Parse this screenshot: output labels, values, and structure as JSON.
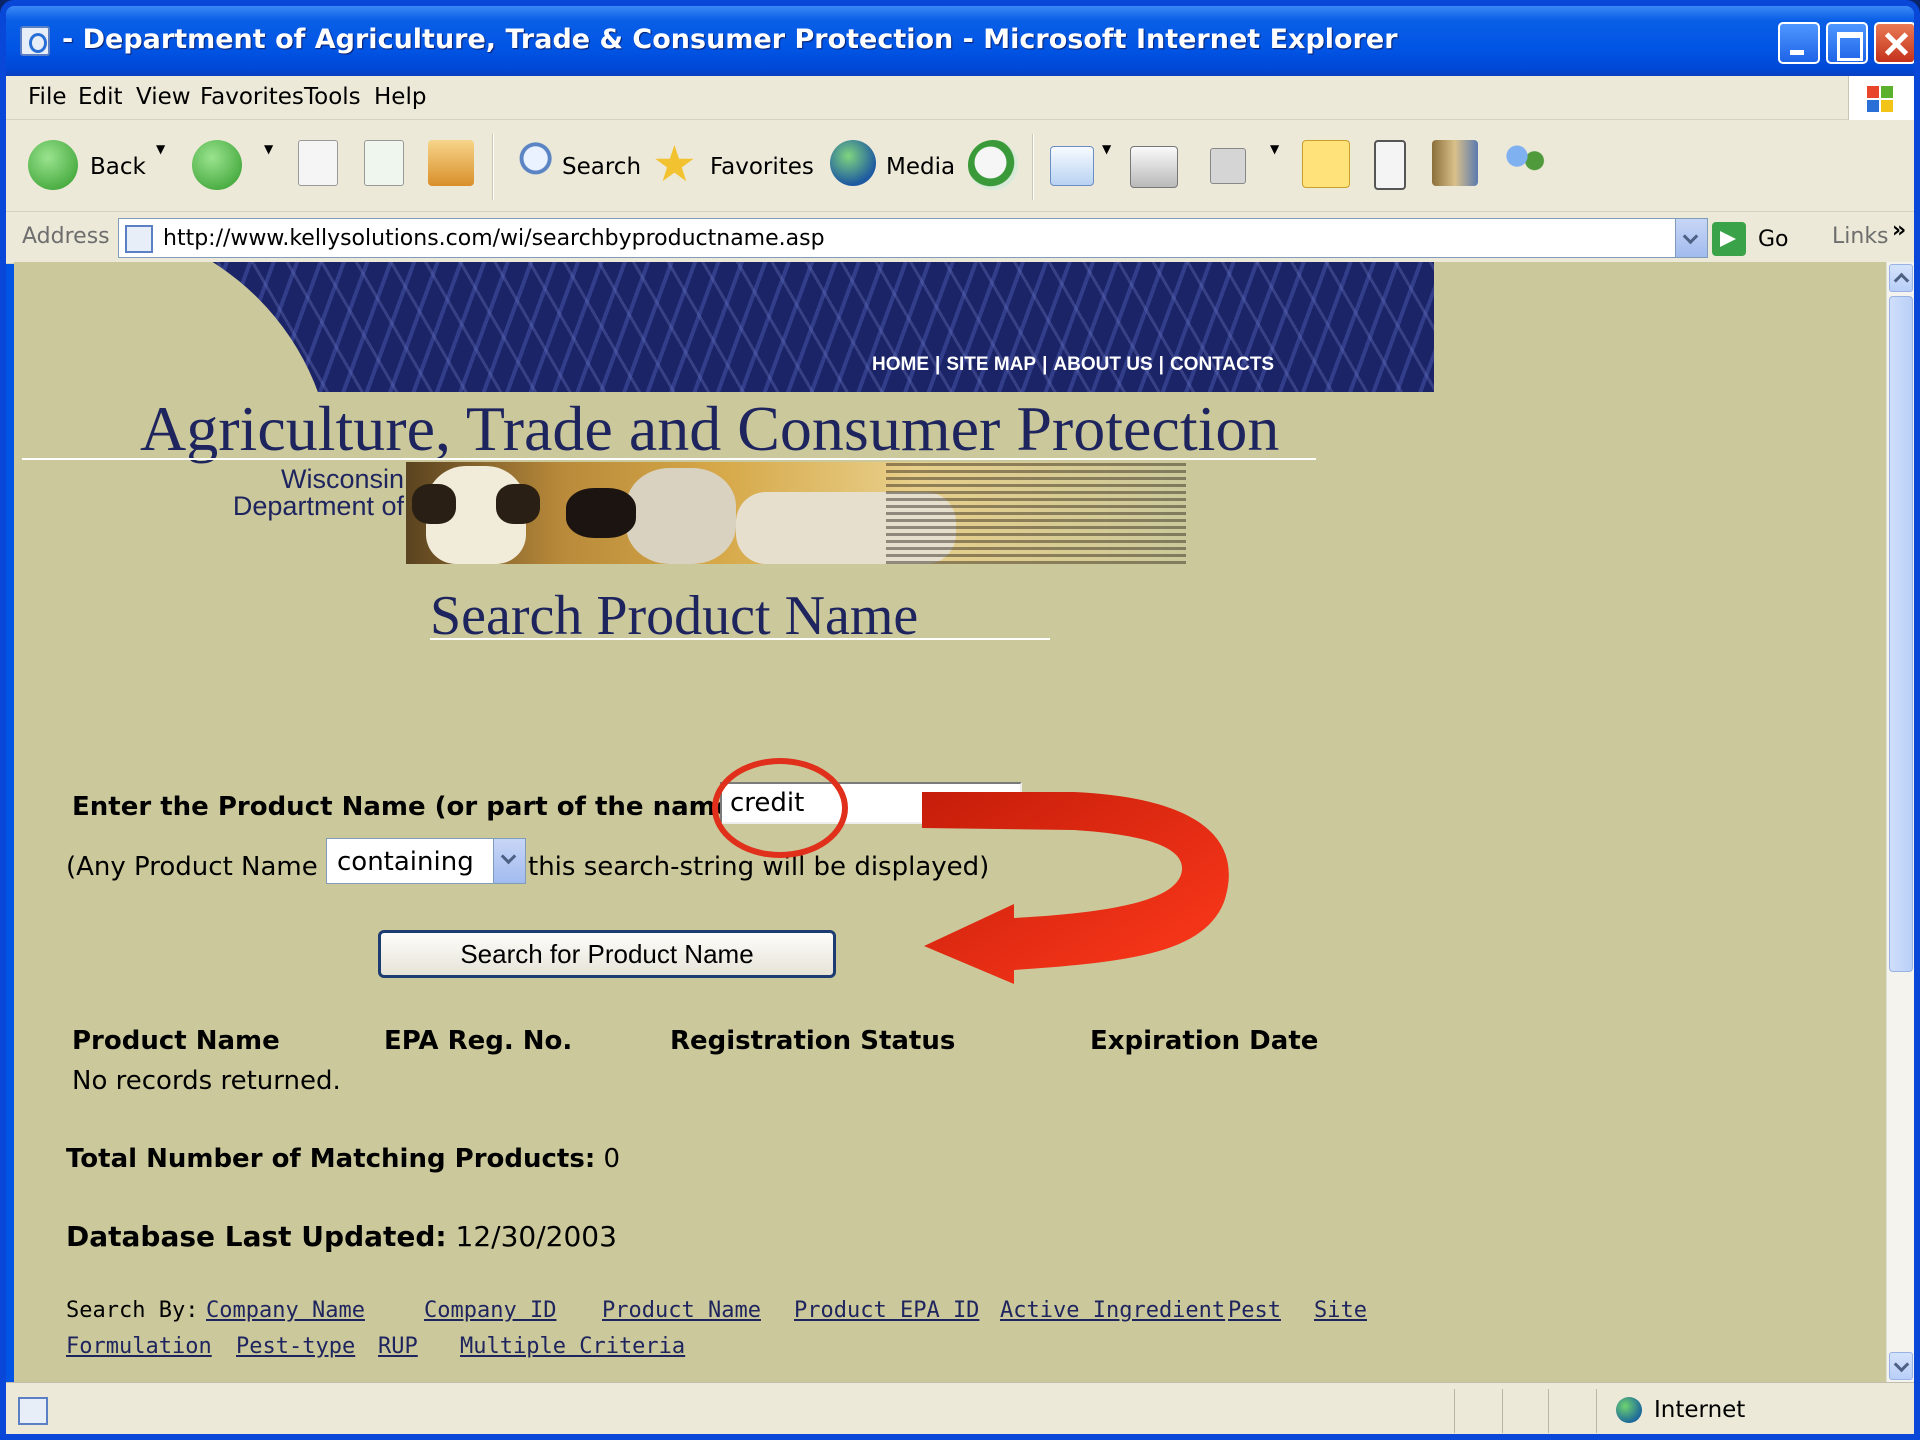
{
  "window": {
    "title": "- Department of Agriculture, Trade & Consumer Protection - Microsoft Internet Explorer"
  },
  "menu": [
    "File",
    "Edit",
    "View",
    "Favorites",
    "Tools",
    "Help"
  ],
  "toolbar": {
    "back": "Back",
    "search": "Search",
    "favorites": "Favorites",
    "media": "Media"
  },
  "address": {
    "label": "Address",
    "url": "http://www.kellysolutions.com/wi/searchbyproductname.asp",
    "go": "Go",
    "links": "Links",
    "more": "»"
  },
  "site": {
    "nav": [
      "HOME",
      "SITE MAP",
      "ABOUT US",
      "CONTACTS"
    ],
    "nav_sep": "|",
    "agency": "Agriculture, Trade and Consumer Protection",
    "wisconsin_line1": "Wisconsin",
    "wisconsin_line2": "Department of",
    "page_heading": "Search Product Name"
  },
  "form": {
    "label": "Enter the Product Name (or part of the name):",
    "name_value": "credit",
    "any_pre": "(Any Product Name",
    "match_mode": "containing",
    "any_post": "this search-string will be displayed)",
    "search_button": "Search for Product Name"
  },
  "results": {
    "columns": [
      "Product Name",
      "EPA Reg. No.",
      "Registration Status",
      "Expiration Date"
    ],
    "empty_message": "No records returned.",
    "total_label": "Total Number of Matching Products:",
    "total_value": "0",
    "updated_label": "Database Last Updated:",
    "updated_value": "12/30/2003"
  },
  "search_by": {
    "label": "Search By:",
    "links": [
      "Company Name",
      "Company ID",
      "Product Name",
      "Product EPA ID",
      "Active Ingredient",
      "Pest",
      "Site",
      "Formulation",
      "Pest-type",
      "RUP",
      "Multiple Criteria"
    ]
  },
  "status": {
    "zone": "Internet"
  },
  "colors": {
    "page_bg": "#cbc99b",
    "banner": "#1c2468",
    "heading": "#1e245e",
    "annotation": "#e0301b"
  }
}
